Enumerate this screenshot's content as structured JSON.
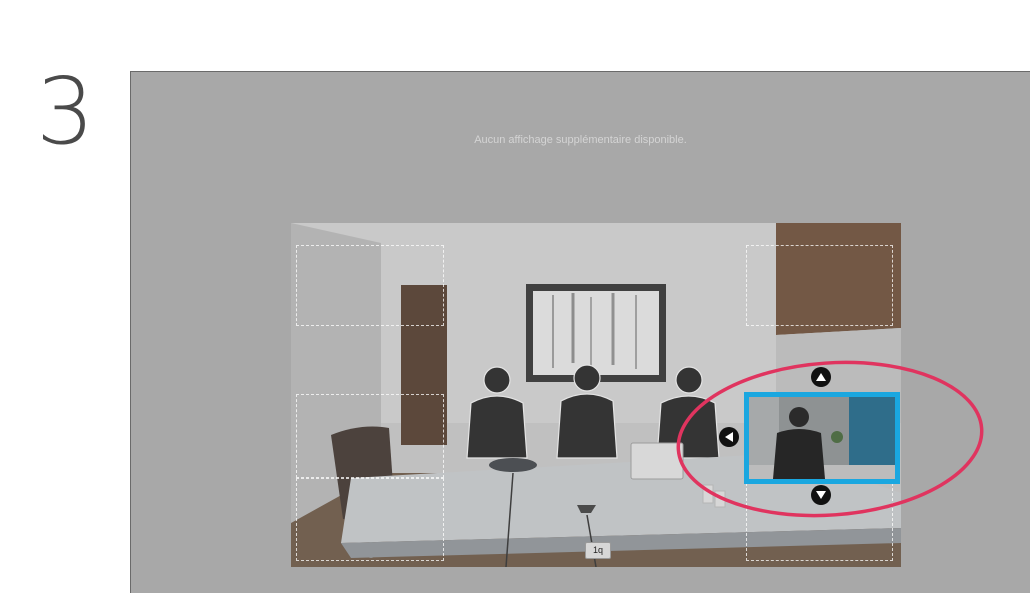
{
  "step": {
    "number": "3"
  },
  "screen": {
    "notice": "Aucun affichage supplémentaire disponible.",
    "mic_label": "1q"
  },
  "pip": {
    "border_color": "#1aa7e0",
    "controls": [
      "arrow-up-icon",
      "arrow-left-icon",
      "arrow-down-icon"
    ]
  },
  "highlight": {
    "color": "#e0345f"
  }
}
